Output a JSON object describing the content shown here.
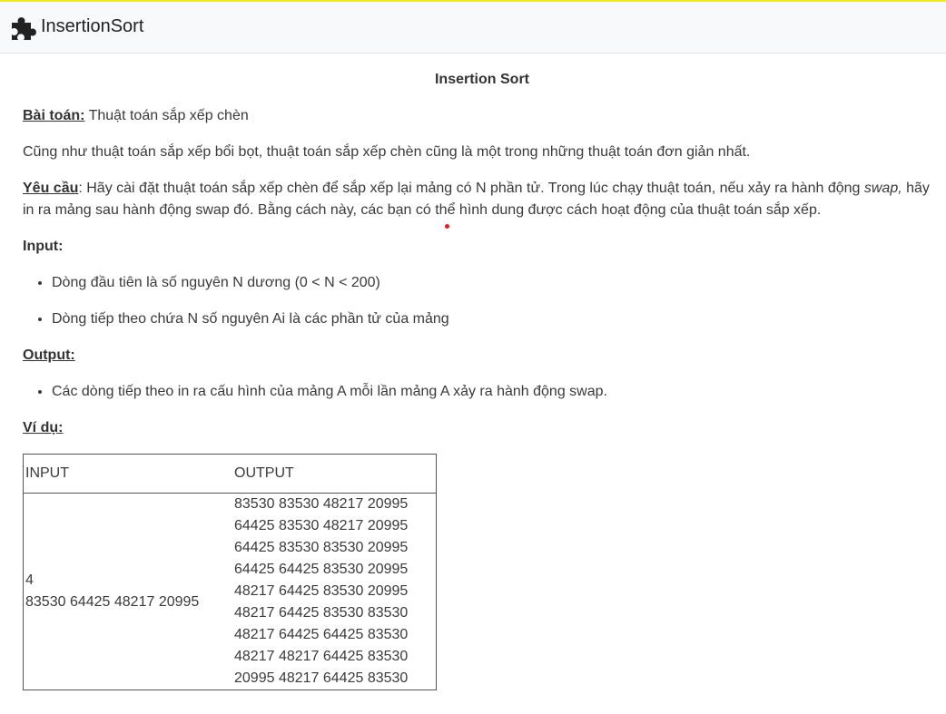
{
  "header": {
    "brand": "InsertionSort",
    "logo_icon": "puzzle-icon"
  },
  "page": {
    "title": "Insertion Sort",
    "problem_label": "Bài toán:",
    "problem_text": " Thuật toán sắp xếp chèn",
    "intro": "Cũng như thuật toán sắp xếp bổi bọt, thuật toán sắp xếp chèn cũng là một trong những thuật toán đơn giản nhất.",
    "requirement_label": "Yêu cầu",
    "requirement_text_1": ": Hãy cài đặt thuật toán sắp xếp chèn để sắp xếp lại mảng có N phần tử. Trong lúc chạy thuật toán, nếu xảy ra hành động ",
    "requirement_swap": "swap,",
    "requirement_text_2": " hãy in ra mảng sau hành động swap đó. Bằng cách này, các bạn có thể hình dung được cách hoạt động của thuật toán sắp xếp.",
    "input_label": "Input:",
    "input_items": [
      "Dòng đầu tiên là số nguyên N dương (0 < N < 200)",
      "Dòng tiếp theo chứa N số nguyên Ai là các phần tử của mảng"
    ],
    "output_label": "Output:",
    "output_items": [
      "Các dòng tiếp theo in ra cấu hình của mảng A mỗi lần mảng A xảy ra hành động swap."
    ],
    "example_label": "Ví dụ:"
  },
  "example_table": {
    "headers": [
      "INPUT",
      "OUTPUT"
    ],
    "input_lines": [
      "4",
      "83530 64425 48217 20995"
    ],
    "output_lines": [
      "83530 83530 48217 20995",
      "64425 83530 48217 20995",
      "64425 83530 83530 20995",
      "64425 64425 83530 20995",
      "48217 64425 83530 20995",
      "48217 64425 83530 83530",
      "48217 64425 64425 83530",
      "48217 48217 64425 83530",
      "20995 48217 64425 83530"
    ]
  }
}
